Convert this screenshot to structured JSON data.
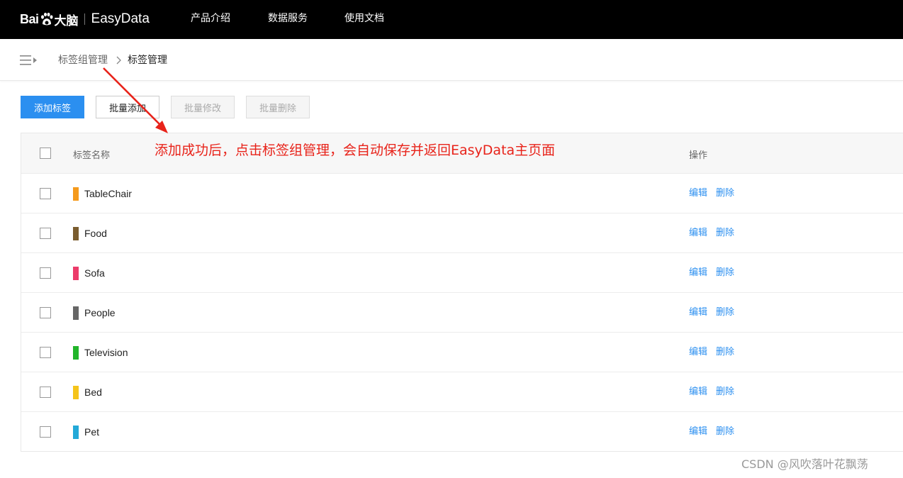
{
  "header": {
    "logo": {
      "bai": "Bai",
      "du": "大脑",
      "product": "EasyData"
    },
    "nav": [
      {
        "label": "产品介绍"
      },
      {
        "label": "数据服务"
      },
      {
        "label": "使用文档"
      }
    ]
  },
  "breadcrumb": {
    "parent": "标签组管理",
    "current": "标签管理"
  },
  "toolbar": {
    "add_label": "添加标签",
    "batch_add_label": "批量添加",
    "batch_edit_label": "批量修改",
    "batch_delete_label": "批量删除"
  },
  "table": {
    "columns": {
      "name": "标签名称",
      "actions": "操作"
    },
    "rows": [
      {
        "name": "TableChair",
        "color": "#f59a1c"
      },
      {
        "name": "Food",
        "color": "#7a5c2e"
      },
      {
        "name": "Sofa",
        "color": "#ec3b6a"
      },
      {
        "name": "People",
        "color": "#666666"
      },
      {
        "name": "Television",
        "color": "#21b52a"
      },
      {
        "name": "Bed",
        "color": "#f5c41a"
      },
      {
        "name": "Pet",
        "color": "#23a9d8"
      }
    ],
    "edit_label": "编辑",
    "delete_label": "删除"
  },
  "annotation": {
    "text": "添加成功后，点击标签组管理，会自动保存并返回EasyData主页面",
    "color": "#e8231a"
  },
  "watermark": "CSDN @风吹落叶花飘荡"
}
